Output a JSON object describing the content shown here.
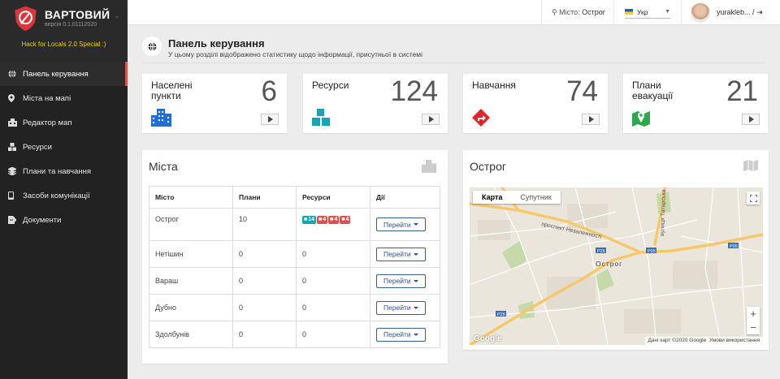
{
  "brand": {
    "title": "ВАРТОВИЙ",
    "version": "версія 0.1.01112020",
    "subtitle": "Hack for Locals 2.0 Special :)"
  },
  "nav": [
    {
      "label": "Панель керування",
      "icon": "globe-icon",
      "active": true
    },
    {
      "label": "Міста на мапі",
      "icon": "map-marker-icon"
    },
    {
      "label": "Редактор мап",
      "icon": "map-editor-icon"
    },
    {
      "label": "Ресурси",
      "icon": "boxes-icon"
    },
    {
      "label": "Плани та навчання",
      "icon": "layers-icon"
    },
    {
      "label": "Засоби комунікації",
      "icon": "mobile-icon"
    },
    {
      "label": "Документи",
      "icon": "document-icon"
    }
  ],
  "topbar": {
    "city_label": "Місто:",
    "city_value": "Острог",
    "lang": "Укр",
    "user": "yurakleb... /"
  },
  "page": {
    "title": "Панель керування",
    "subtitle": "У цьому розділі відображено статистику щодо інформації, присутньої в системі"
  },
  "stats": [
    {
      "label": "Населені пункти",
      "value": "6",
      "icon": "city-icon",
      "color": "#1e6fd9"
    },
    {
      "label": "Ресурси",
      "value": "124",
      "icon": "boxes-icon",
      "color": "#1ba3b5"
    },
    {
      "label": "Навчання",
      "value": "74",
      "icon": "direction-icon",
      "color": "#e0262b"
    },
    {
      "label": "Плани евакуації",
      "value": "21",
      "icon": "map-pin-icon",
      "color": "#2ea84a"
    }
  ],
  "cities": {
    "title": "Міста",
    "columns": [
      "Місто",
      "Плани",
      "Ресурси",
      "Дії"
    ],
    "action_label": "Перейти",
    "rows": [
      {
        "city": "Острог",
        "plans": "10",
        "resources": "",
        "badges": [
          {
            "value": "14",
            "color": "#1ba3b5",
            "icon": "building-icon"
          },
          {
            "value": "4",
            "color": "#d9534f",
            "icon": "car-icon"
          },
          {
            "value": "4",
            "color": "#d9534f",
            "icon": "medical-icon"
          },
          {
            "value": "4",
            "color": "#d9534f",
            "icon": "ambulance-icon"
          }
        ]
      },
      {
        "city": "Нетішин",
        "plans": "0",
        "resources": "0",
        "badges": []
      },
      {
        "city": "Вараш",
        "plans": "0",
        "resources": "0",
        "badges": []
      },
      {
        "city": "Дубно",
        "plans": "0",
        "resources": "0",
        "badges": []
      },
      {
        "city": "Здолбунів",
        "plans": "0",
        "resources": "0",
        "badges": []
      }
    ]
  },
  "map": {
    "title": "Острог",
    "tab_map": "Карта",
    "tab_sat": "Супутник",
    "city_label": "Острог",
    "streets": [
      "проспект Незалежності",
      "вулиця Татарська"
    ],
    "road_labels": [
      "P26",
      "P05"
    ],
    "attribution": "Дані карт ©2020 Google",
    "terms": "Умови використання",
    "google": "Google"
  }
}
